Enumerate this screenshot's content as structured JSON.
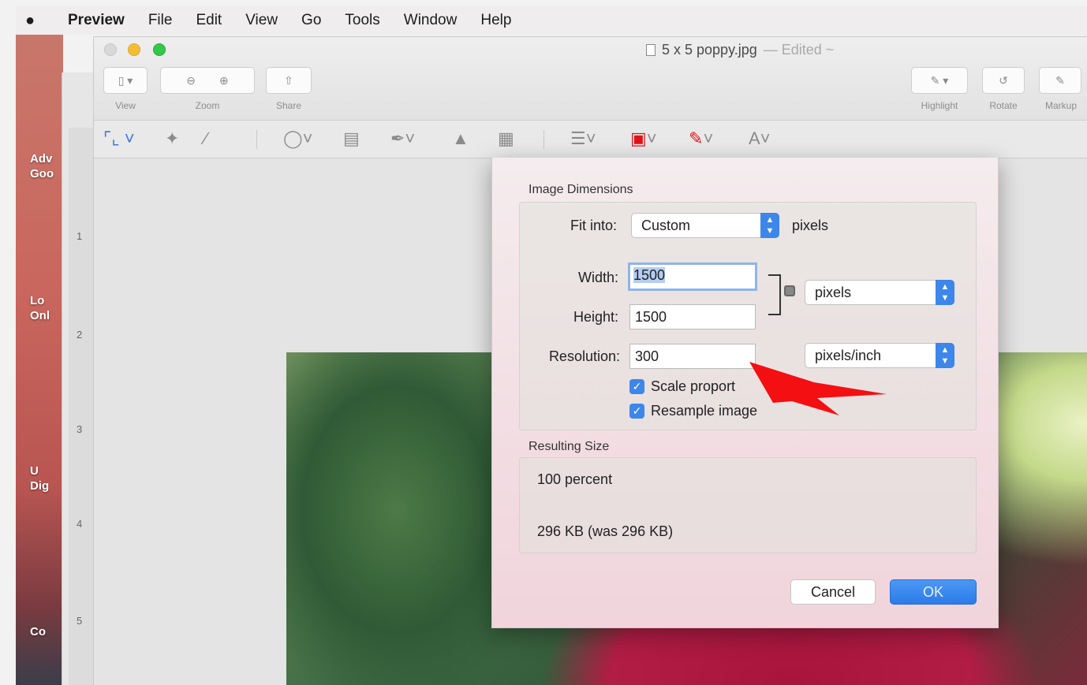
{
  "menubar": {
    "apple_glyph": "",
    "items": [
      "Preview",
      "File",
      "Edit",
      "View",
      "Go",
      "Tools",
      "Window",
      "Help"
    ]
  },
  "desktop": {
    "labels": [
      "Adv\nGoo",
      "Lo\nOnl",
      "U\nDig",
      "Co"
    ]
  },
  "back_window": {
    "page_numbers": [
      "1",
      "2",
      "3",
      "4",
      "5"
    ]
  },
  "window": {
    "title": "5 x 5 poppy.jpg",
    "title_suffix": "— Edited ~",
    "toolbar": {
      "view_label": "View",
      "zoom_label": "Zoom",
      "share_label": "Share",
      "highlight_label": "Highlight",
      "rotate_label": "Rotate",
      "markup_label": "Markup"
    }
  },
  "dialog": {
    "dimensions_title": "Image Dimensions",
    "fit_into_label": "Fit into:",
    "fit_into_value": "Custom",
    "fit_into_unit": "pixels",
    "width_label": "Width:",
    "width_value": "1500",
    "height_label": "Height:",
    "height_value": "1500",
    "size_unit_value": "pixels",
    "resolution_label": "Resolution:",
    "resolution_value": "300",
    "resolution_unit_value": "pixels/inch",
    "scale_label": "Scale proport",
    "resample_label": "Resample image",
    "resulting_title": "Resulting Size",
    "percent_text": "100 percent",
    "size_text": "296 KB (was 296 KB)",
    "cancel_label": "Cancel",
    "ok_label": "OK"
  },
  "colors": {
    "accent": "#3d86ea",
    "markup_red": "#e0141a",
    "arrow_red": "#f40f12"
  }
}
